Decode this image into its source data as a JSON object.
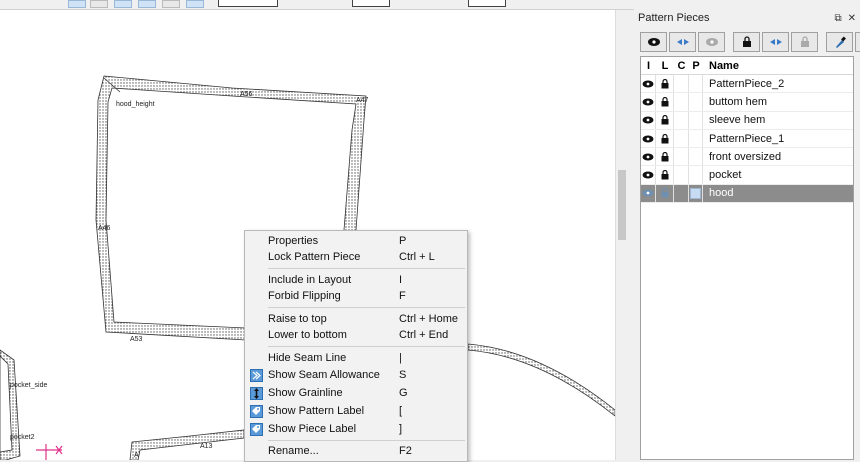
{
  "dock": {
    "title": "Pattern Pieces",
    "controls": [
      "⧉",
      "✕"
    ]
  },
  "table": {
    "headers": [
      "I",
      "L",
      "C",
      "P",
      "Name"
    ],
    "rows": [
      {
        "name": "PatternPiece_2",
        "selected": false
      },
      {
        "name": "buttom hem",
        "selected": false
      },
      {
        "name": "sleeve hem",
        "selected": false
      },
      {
        "name": "PatternPiece_1",
        "selected": false
      },
      {
        "name": "front oversized",
        "selected": false
      },
      {
        "name": "pocket",
        "selected": false
      },
      {
        "name": "hood",
        "selected": true
      }
    ]
  },
  "canvas_labels": {
    "hood_height": "hood_height",
    "a56": "A56",
    "a47": "A47",
    "a46": "A46",
    "a53": "A53",
    "pocket_side": "pocket_side",
    "pocket2": "pocket2",
    "a13": "A13",
    "a": "A"
  },
  "menu": {
    "items": [
      {
        "label": "Properties",
        "shortcut": "P"
      },
      {
        "label": "Lock Pattern Piece",
        "shortcut": "Ctrl + L"
      },
      {
        "label": "Include in Layout",
        "shortcut": "I"
      },
      {
        "label": "Forbid Flipping",
        "shortcut": "F"
      },
      {
        "label": "Raise to top",
        "shortcut": "Ctrl + Home"
      },
      {
        "label": "Lower to bottom",
        "shortcut": "Ctrl + End"
      },
      {
        "label": "Hide Seam Line",
        "shortcut": "|"
      },
      {
        "label": "Show Seam Allowance",
        "shortcut": "S"
      },
      {
        "label": "Show Grainline",
        "shortcut": "G"
      },
      {
        "label": "Show Pattern Label",
        "shortcut": "["
      },
      {
        "label": "Show Piece Label",
        "shortcut": "]"
      },
      {
        "label": "Rename...",
        "shortcut": "F2"
      }
    ]
  },
  "colors": {
    "accent": "#5a9ad8",
    "selected_row": "#8c8c8c",
    "marker": "#e0308a"
  }
}
